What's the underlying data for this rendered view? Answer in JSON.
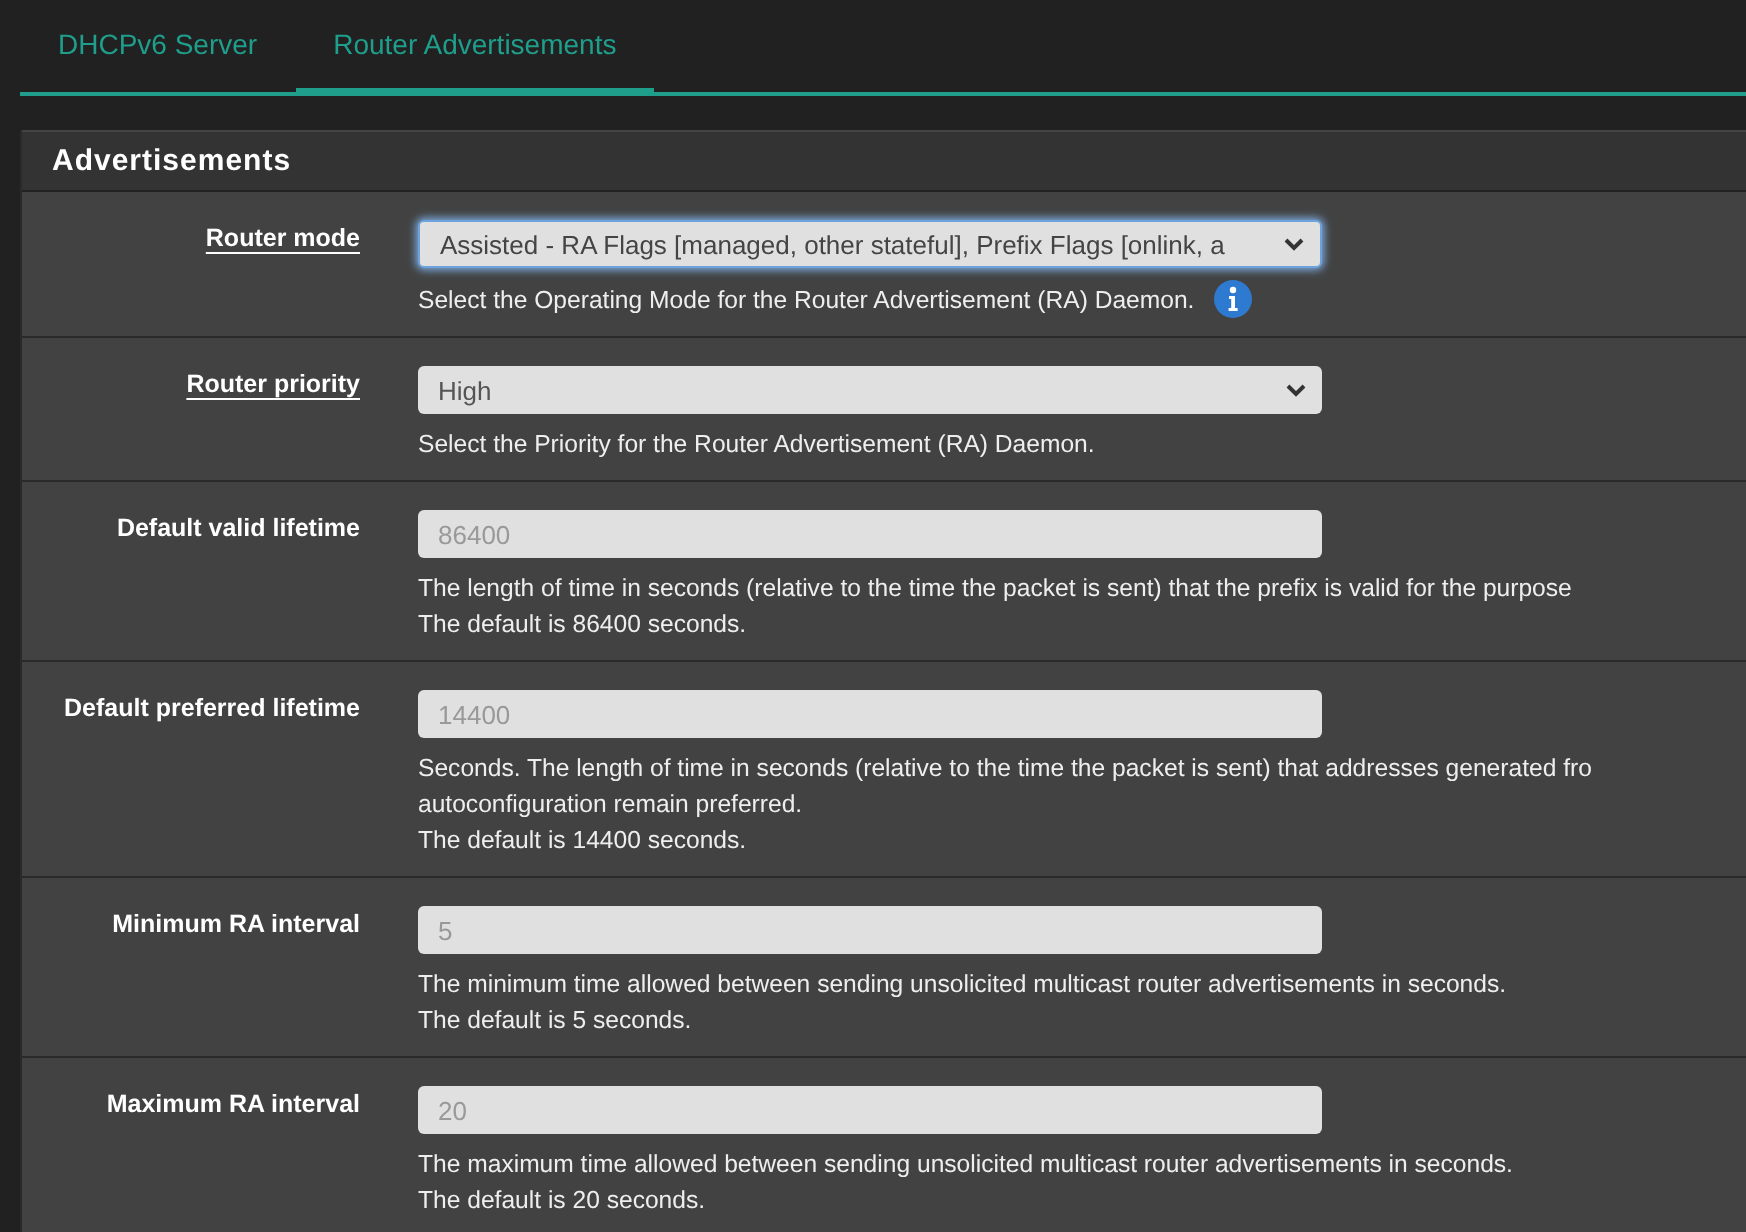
{
  "tabs": [
    {
      "label": "DHCPv6 Server",
      "selected": false
    },
    {
      "label": "Router Advertisements",
      "selected": true
    }
  ],
  "panel": {
    "title": "Advertisements",
    "rows": [
      {
        "label": "Router mode",
        "help_link": true,
        "kind": "select",
        "value": "Assisted - RA Flags [managed, other stateful], Prefix Flags [onlink, a",
        "focused": true,
        "help": [
          "Select the Operating Mode for the Router Advertisement (RA) Daemon."
        ],
        "info": true
      },
      {
        "label": "Router priority",
        "help_link": true,
        "kind": "select",
        "value": "High",
        "focused": false,
        "help": [
          "Select the Priority for the Router Advertisement (RA) Daemon."
        ],
        "info": false
      },
      {
        "label": "Default valid lifetime",
        "help_link": false,
        "kind": "number",
        "placeholder": "86400",
        "help": [
          "The length of time in seconds (relative to the time the packet is sent) that the prefix is valid for the purpose",
          "The default is 86400 seconds."
        ],
        "info": false
      },
      {
        "label": "Default preferred lifetime",
        "help_link": false,
        "kind": "number",
        "placeholder": "14400",
        "help": [
          "Seconds. The length of time in seconds (relative to the time the packet is sent) that addresses generated fro",
          "autoconfiguration remain preferred.",
          "The default is 14400 seconds."
        ],
        "info": false
      },
      {
        "label": "Minimum RA interval",
        "help_link": false,
        "kind": "number",
        "placeholder": "5",
        "help": [
          "The minimum time allowed between sending unsolicited multicast router advertisements in seconds.",
          "The default is 5 seconds."
        ],
        "info": false
      },
      {
        "label": "Maximum RA interval",
        "help_link": false,
        "kind": "number",
        "placeholder": "20",
        "help": [
          "The maximum time allowed between sending unsolicited multicast router advertisements in seconds.",
          "The default is 20 seconds."
        ],
        "info": false
      }
    ]
  }
}
